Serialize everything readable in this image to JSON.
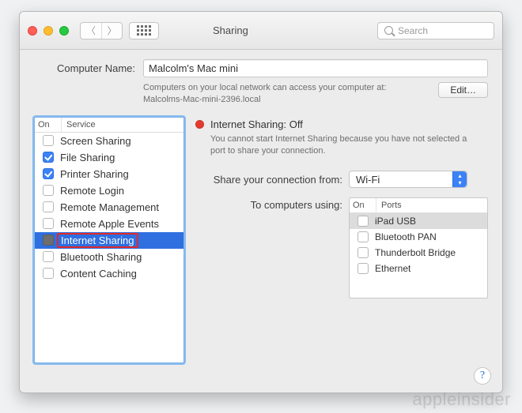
{
  "window": {
    "title": "Sharing"
  },
  "toolbar": {
    "search_placeholder": "Search"
  },
  "computer_name": {
    "label": "Computer Name:",
    "value": "Malcolm's Mac mini",
    "hint_line1": "Computers on your local network can access your computer at:",
    "hint_line2": "Malcolms-Mac-mini-2396.local",
    "edit_label": "Edit…"
  },
  "service_table": {
    "headers": {
      "on": "On",
      "service": "Service"
    },
    "rows": [
      {
        "checked": false,
        "label": "Screen Sharing",
        "selected": false
      },
      {
        "checked": true,
        "label": "File Sharing",
        "selected": false
      },
      {
        "checked": true,
        "label": "Printer Sharing",
        "selected": false
      },
      {
        "checked": false,
        "label": "Remote Login",
        "selected": false
      },
      {
        "checked": false,
        "label": "Remote Management",
        "selected": false
      },
      {
        "checked": false,
        "label": "Remote Apple Events",
        "selected": false
      },
      {
        "checked": false,
        "label": "Internet Sharing",
        "selected": true
      },
      {
        "checked": false,
        "label": "Bluetooth Sharing",
        "selected": false
      },
      {
        "checked": false,
        "label": "Content Caching",
        "selected": false
      }
    ]
  },
  "status": {
    "title": "Internet Sharing: Off",
    "color": "#e23a2f",
    "description": "You cannot start Internet Sharing because you have not selected a port to share your connection."
  },
  "share_from": {
    "label": "Share your connection from:",
    "value": "Wi-Fi"
  },
  "to_using": {
    "label": "To computers using:",
    "headers": {
      "on": "On",
      "ports": "Ports"
    },
    "rows": [
      {
        "checked": false,
        "label": "iPad USB",
        "selected": true
      },
      {
        "checked": false,
        "label": "Bluetooth PAN",
        "selected": false
      },
      {
        "checked": false,
        "label": "Thunderbolt Bridge",
        "selected": false
      },
      {
        "checked": false,
        "label": "Ethernet",
        "selected": false
      }
    ]
  },
  "help_symbol": "?",
  "watermark": "appleinsider"
}
